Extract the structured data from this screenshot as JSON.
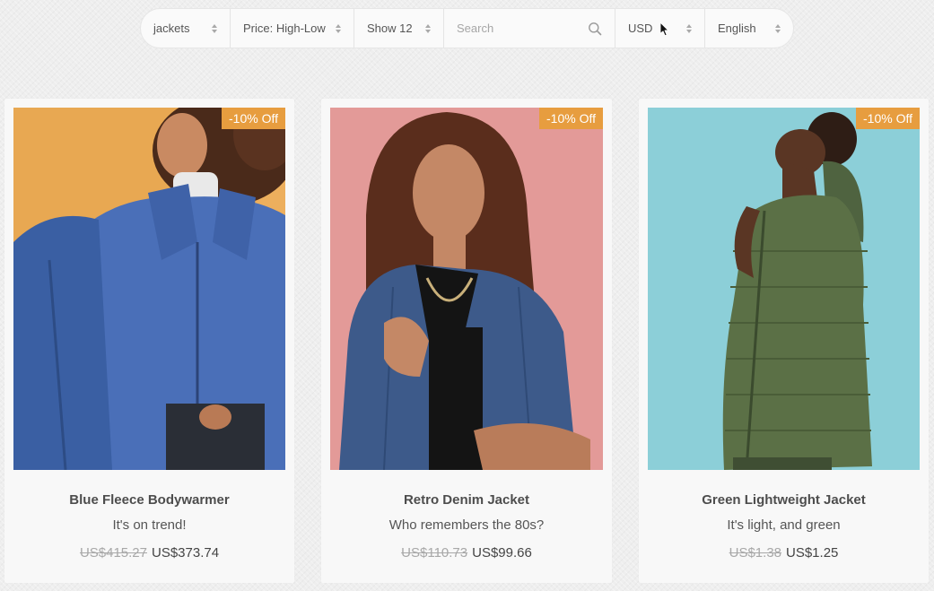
{
  "toolbar": {
    "category": "jackets",
    "sort": "Price: High-Low",
    "show": "Show 12",
    "search_placeholder": "Search",
    "search_value": "",
    "currency": "USD",
    "language": "English"
  },
  "products": [
    {
      "name": "Blue Fleece Bodywarmer",
      "tagline": "It's on trend!",
      "old_price": "US$415.27",
      "price": "US$373.74",
      "badge": "-10% Off",
      "photo_bg": "#e8a852",
      "garment_color": "#4a6fb8"
    },
    {
      "name": "Retro Denim Jacket",
      "tagline": "Who remembers the 80s?",
      "old_price": "US$110.73",
      "price": "US$99.66",
      "badge": "-10% Off",
      "photo_bg": "#e39a98",
      "garment_color": "#3d5a8a"
    },
    {
      "name": "Green Lightweight Jacket",
      "tagline": "It's light, and green",
      "old_price": "US$1.38",
      "price": "US$1.25",
      "badge": "-10% Off",
      "photo_bg": "#8ccfd8",
      "garment_color": "#5b7046"
    }
  ],
  "colors": {
    "badge": "#e79d3f",
    "card_bg": "#f8f8f8",
    "page_bg": "#eeeeee"
  }
}
